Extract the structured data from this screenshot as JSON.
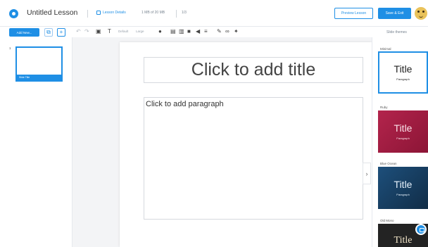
{
  "header": {
    "lesson_title": "Untitled Lesson",
    "lesson_details_label": "Lesson Details",
    "size_info": "1 MB of 20 MB",
    "count_info": "1/3",
    "preview_label": "Preview Lesson",
    "save_label": "Save & Exit",
    "accent_color": "#1f8fe5"
  },
  "toolbar": {
    "add_new_label": "Add New...",
    "font_dropdown": "Default",
    "size_dropdown": "Large",
    "slide_themes_label": "Slide themes"
  },
  "slides": {
    "items": [
      {
        "number": "1",
        "label": "Slide Title"
      }
    ]
  },
  "canvas": {
    "title_placeholder": "Click to add title",
    "paragraph_placeholder": "Click to add paragraph"
  },
  "themes": [
    {
      "name": "Minimal",
      "title": "Title",
      "paragraph": "Paragraph"
    },
    {
      "name": "Ruby",
      "title": "Title",
      "paragraph": "Paragraph"
    },
    {
      "name": "Blue Ocean",
      "title": "Title",
      "paragraph": "Paragraph"
    },
    {
      "name": "Old Mono",
      "title": "Title",
      "paragraph": ""
    }
  ]
}
